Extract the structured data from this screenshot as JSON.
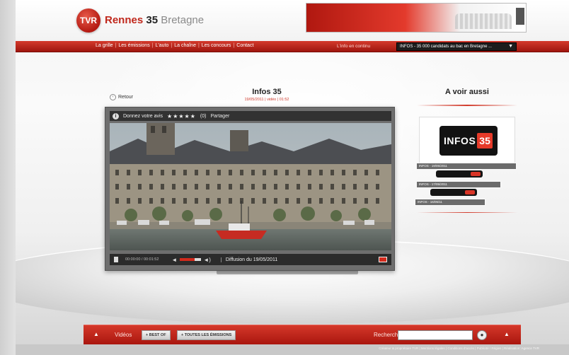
{
  "site": {
    "logo_badge": "TVR",
    "logo_part1": "Rennes",
    "logo_part2": "35",
    "logo_part3": "Bretagne"
  },
  "nav": {
    "items": [
      "La grille",
      "Les émissions",
      "L'auto",
      "La chaîne",
      "Les concours",
      "Contact"
    ],
    "info_label": "L'info en continu",
    "info_select_value": "INFOS - 35 000 candidats au bac en Bretagne ..."
  },
  "video": {
    "back_label": "Retour",
    "title": "Infos 35",
    "date_line": "19/05/2011 | vidéo | 01:52",
    "rate_label": "Donnez votre avis",
    "stars": "★★★★★",
    "rating_count": "(0)",
    "share_label": "Partager",
    "time_readout": "00:00:00 / 00:01:52",
    "broadcast_label": "Diffusion du 19/05/2011",
    "volume_level": 0.7
  },
  "aside": {
    "title": "A voir aussi",
    "logo_text": "INFOS",
    "logo_num": "35",
    "items": [
      "INFOS - 19/05/2011",
      "INFOS - 17/05/2011",
      "INFOS - 16/05/11"
    ]
  },
  "bottom": {
    "videos_label": "Vidéos",
    "best_of_label": "+ BEST OF",
    "all_shows_label": "+ TOUTES LES ÉMISSIONS",
    "search_label": "Recherche",
    "search_value": "",
    "footer_text": "Créateur & propriétaire TVR | Mentions légales | Conditions d'accès | Publicité / Régies | Réalisation: Agence TVR"
  },
  "colors": {
    "brand_red": "#c0281c",
    "nav_red": "#b31d14",
    "dark": "#1d1d1d"
  }
}
